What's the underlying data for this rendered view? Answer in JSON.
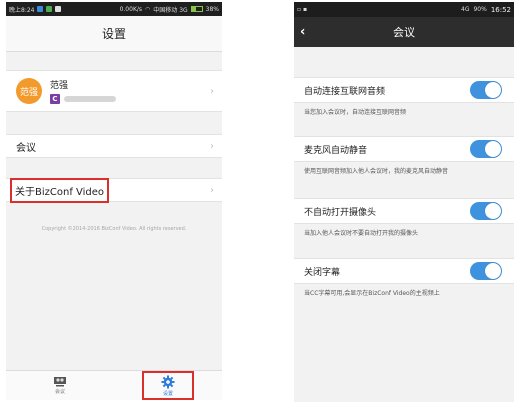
{
  "left": {
    "statusbar": {
      "time": "晚上8:24",
      "network": "0.00K/s",
      "carrier": "中国移动 3G",
      "battery": "38%"
    },
    "title": "设置",
    "profile": {
      "avatar_text": "范强",
      "name": "范强",
      "badge": "C"
    },
    "rows": {
      "meeting": "会议",
      "about": "关于BizConf Video"
    },
    "copyright": "Copyright ©2014-2016 BizConf Video. All rights reserved.",
    "tabs": [
      {
        "label": "会议",
        "icon": "meeting-icon"
      },
      {
        "label": "设置",
        "icon": "gear-icon"
      }
    ]
  },
  "right": {
    "statusbar": {
      "signal": "4G",
      "battery": "90%",
      "time": "16:52"
    },
    "title": "会议",
    "settings": [
      {
        "label": "自动连接互联网音频",
        "desc": "当您加入会议时，自动连接互联网音频",
        "enabled": true
      },
      {
        "label": "麦克风自动静音",
        "desc": "使用互联网音频加入他人会议时，我的麦克风自动静音",
        "enabled": true
      },
      {
        "label": "不自动打开摄像头",
        "desc": "当加入他人会议时不要自动打开我的摄像头",
        "enabled": true
      },
      {
        "label": "关闭字幕",
        "desc": "当CC字幕可用,会显示在BizConf Video的主视频上",
        "enabled": true
      }
    ]
  },
  "colors": {
    "accent": "#3f93de",
    "highlight": "#d9302c",
    "avatar": "#f39a2c",
    "badge": "#7b3fa3"
  }
}
